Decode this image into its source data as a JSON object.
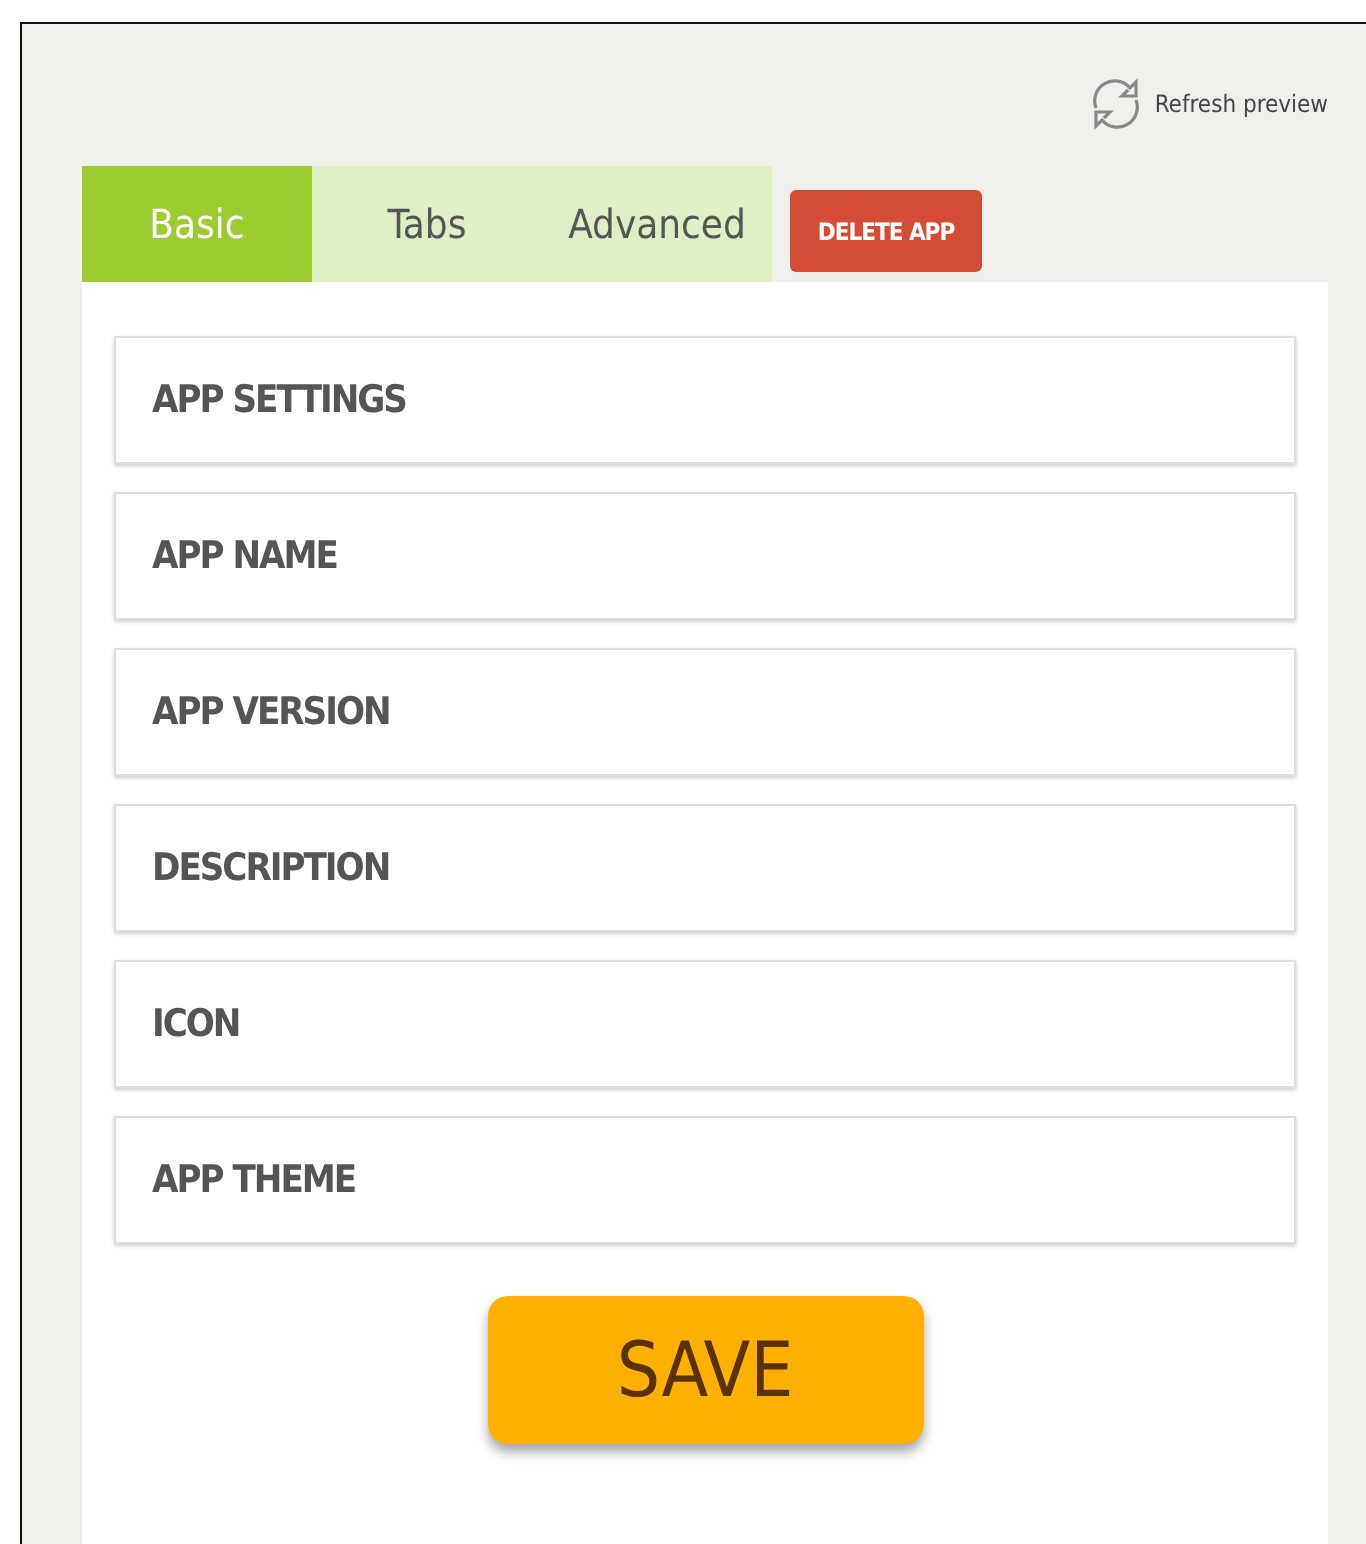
{
  "refresh": {
    "label": "Refresh preview"
  },
  "tabs": [
    {
      "label": "Basic",
      "selected": true
    },
    {
      "label": "Tabs",
      "selected": false
    },
    {
      "label": "Advanced",
      "selected": false
    }
  ],
  "delete_button": "DELETE APP",
  "sections": [
    "APP SETTINGS",
    "APP NAME",
    "APP VERSION",
    "DESCRIPTION",
    "ICON",
    "APP THEME"
  ],
  "save_button": "SAVE"
}
